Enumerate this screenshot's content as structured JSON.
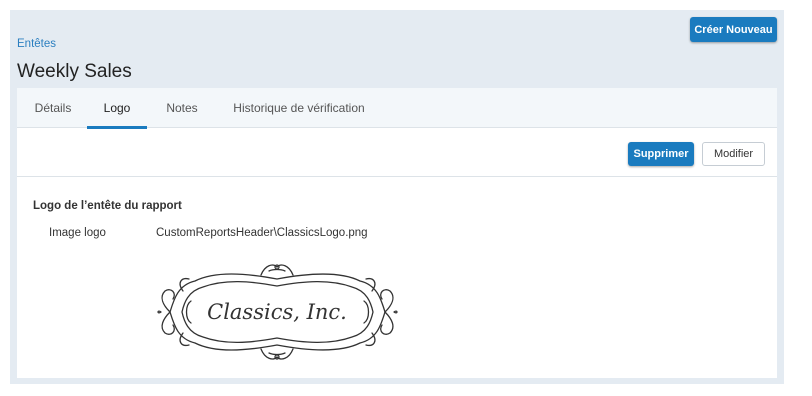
{
  "header": {
    "create_label": "Créer Nouveau",
    "breadcrumb": "Entêtes",
    "title": "Weekly Sales"
  },
  "tabs": [
    {
      "label": "Détails",
      "active": false
    },
    {
      "label": "Logo",
      "active": true
    },
    {
      "label": "Notes",
      "active": false
    },
    {
      "label": "Historique de vérification",
      "active": false
    }
  ],
  "toolbar": {
    "delete_label": "Supprimer",
    "edit_label": "Modifier"
  },
  "logo_section": {
    "title": "Logo de l’entête du rapport",
    "field_label": "Image logo",
    "field_value": "CustomReportsHeader\\ClassicsLogo.png",
    "logo_text": "Classics, Inc."
  },
  "colors": {
    "accent": "#1a7bbf",
    "frame_background": "#e4ebf2",
    "tab_bar_background": "#f3f7fa"
  }
}
